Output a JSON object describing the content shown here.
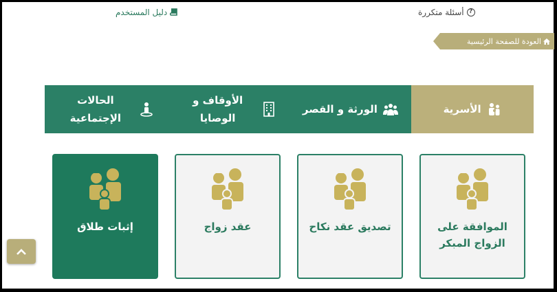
{
  "top_links": {
    "faq": "أسئلة متكررة",
    "guide": "دليل المستخدم"
  },
  "back_home": "العودة للصفحة الرئيسية",
  "tabs": [
    {
      "label": "الأسرية",
      "active": true
    },
    {
      "label": "الورثة و القصر",
      "active": false
    },
    {
      "label": "الأوقاف و الوصايا",
      "active": false
    },
    {
      "label": "الحالات الإجتماعية",
      "active": false
    }
  ],
  "cards": [
    {
      "label": "الموافقة على الزواج المبكر",
      "selected": false
    },
    {
      "label": "تصديق عقد نكاح",
      "selected": false
    },
    {
      "label": "عقد زواج",
      "selected": false
    },
    {
      "label": "إثبات طلاق",
      "selected": true
    }
  ],
  "colors": {
    "green": "#2b8066",
    "gold": "#bbb07b",
    "card_bg": "#f3f3f3"
  }
}
